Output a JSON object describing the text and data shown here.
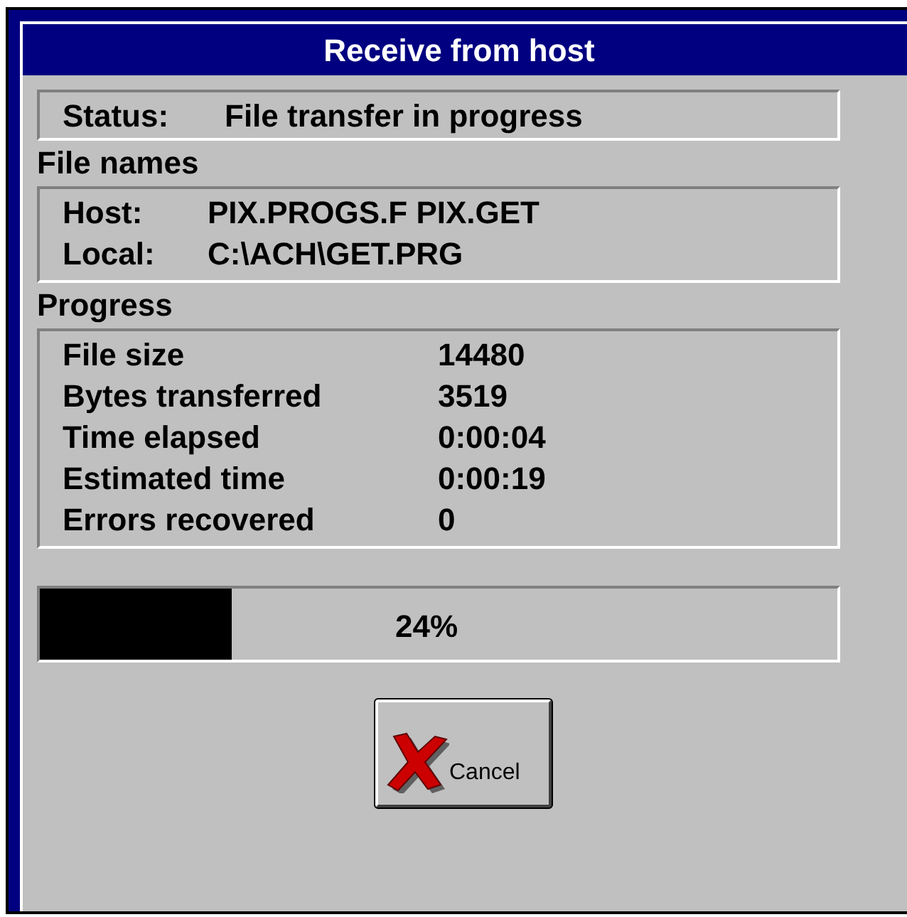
{
  "window": {
    "title": "Receive from host"
  },
  "status": {
    "label": "Status:",
    "value": "File transfer in progress"
  },
  "file_names": {
    "heading": "File names",
    "rows": [
      {
        "label": "Host:",
        "value": "PIX.PROGS.F PIX.GET"
      },
      {
        "label": "Local:",
        "value": "C:\\ACH\\GET.PRG"
      }
    ]
  },
  "progress": {
    "heading": "Progress",
    "rows": [
      {
        "label": "File size",
        "value": "14480"
      },
      {
        "label": "Bytes transferred",
        "value": "3519"
      },
      {
        "label": "Time elapsed",
        "value": "0:00:04"
      },
      {
        "label": "Estimated time",
        "value": "0:00:19"
      },
      {
        "label": "Errors recovered",
        "value": "0"
      }
    ]
  },
  "progress_bar": {
    "level": 0.24,
    "reading": "24%"
  },
  "buttons": [
    {
      "label": "Cancel"
    }
  ]
}
